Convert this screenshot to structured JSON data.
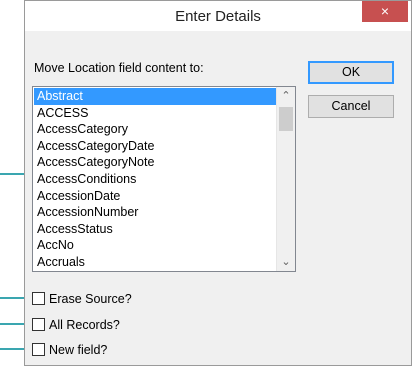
{
  "dialog": {
    "title": "Enter Details",
    "close_glyph": "×",
    "prompt": "Move Location field content to:",
    "ok_label": "OK",
    "cancel_label": "Cancel"
  },
  "list": {
    "items": [
      "Abstract",
      "ACCESS",
      "AccessCategory",
      "AccessCategoryDate",
      "AccessCategoryNote",
      "AccessConditions",
      "AccessionDate",
      "AccessionNumber",
      "AccessStatus",
      "AccNo",
      "Accruals"
    ],
    "selected_index": 0,
    "scroll_up_glyph": "⌃",
    "scroll_down_glyph": "⌄"
  },
  "options": {
    "erase_source": {
      "label": "Erase Source?",
      "checked": false
    },
    "all_records": {
      "label": "All Records?",
      "checked": false
    },
    "new_field": {
      "label": "New field?",
      "checked": false
    }
  },
  "colors": {
    "selection": "#3399ff",
    "close_button": "#c75050",
    "pointer_arrows": "#3aa6b0"
  }
}
